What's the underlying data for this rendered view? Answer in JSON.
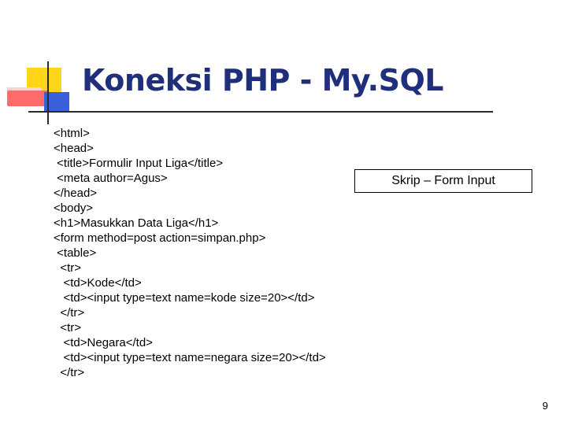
{
  "slide": {
    "title": "Koneksi PHP - My.SQL",
    "callout": "Skrip – Form Input",
    "page_number": "9",
    "accent_colors": {
      "yellow": "#ffd51a",
      "red": "#ff6a6a",
      "blue": "#3a5fd9",
      "title": "#1f2f7c"
    },
    "code_lines": [
      "<html>",
      "<head>",
      " <title>Formulir Input Liga</title>",
      " <meta author=Agus>",
      "</head>",
      "<body>",
      "<h1>Masukkan Data Liga</h1>",
      "<form method=post action=simpan.php>",
      " <table>",
      "  <tr>",
      "   <td>Kode</td>",
      "   <td><input type=text name=kode size=20></td>",
      "  </tr>",
      "  <tr>",
      "   <td>Negara</td>",
      "   <td><input type=text name=negara size=20></td>",
      "  </tr>"
    ]
  }
}
